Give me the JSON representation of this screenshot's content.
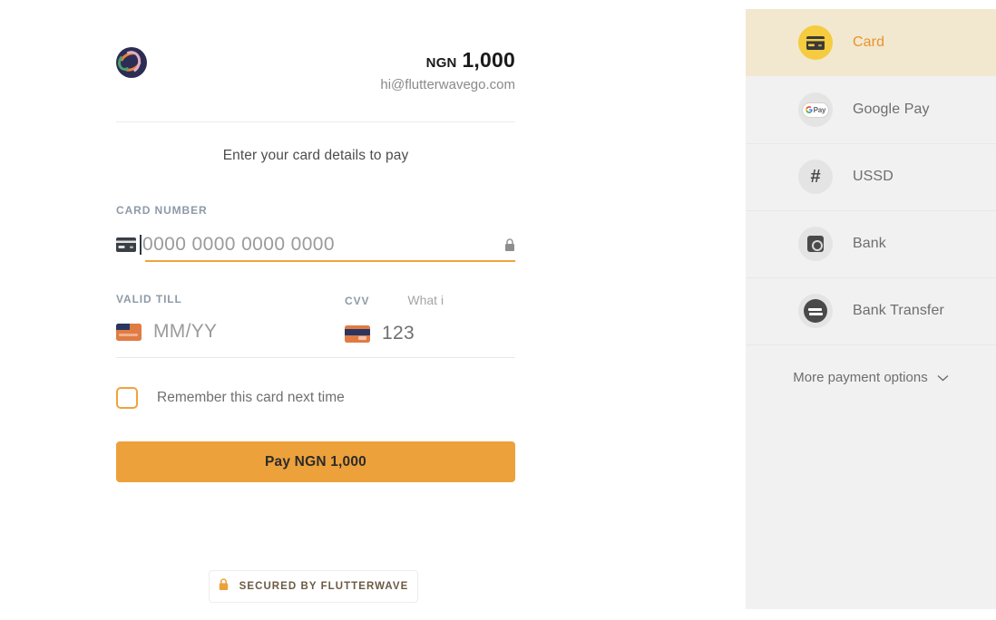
{
  "checkout": {
    "logo_icon": "flutterwave-merchant-logo",
    "currency": "NGN",
    "amount": "1,000",
    "merchant_email": "hi@flutterwavego.com",
    "instruction": "Enter your card details to pay",
    "card_number": {
      "label": "CARD NUMBER",
      "placeholder": "0000 0000 0000 0000",
      "value": "",
      "left_icon": "credit-card-icon",
      "right_icon": "lock-icon"
    },
    "valid_till": {
      "label": "VALID TILL",
      "placeholder": "MM/YY",
      "value": "",
      "icon": "card-front-icon"
    },
    "cvv": {
      "label": "CVV",
      "placeholder": "123",
      "value": "",
      "icon": "card-back-icon",
      "help_link": "What i"
    },
    "remember_card": {
      "label": "Remember this card next time",
      "checked": false
    },
    "pay_button": "Pay NGN 1,000",
    "secured_badge": {
      "text": "SECURED BY FLUTTERWAVE",
      "icon": "padlock-icon"
    }
  },
  "sidebar": {
    "methods": [
      {
        "label": "Card",
        "icon": "credit-card-icon",
        "active": true
      },
      {
        "label": "Google Pay",
        "icon": "google-pay-icon",
        "active": false
      },
      {
        "label": "USSD",
        "icon": "hash-icon",
        "active": false
      },
      {
        "label": "Bank",
        "icon": "safe-vault-icon",
        "active": false
      },
      {
        "label": "Bank Transfer",
        "icon": "transfer-arrows-icon",
        "active": false
      }
    ],
    "more_options": {
      "label": "More payment options",
      "icon": "chevron-down-icon"
    }
  },
  "colors": {
    "accent_orange": "#eda13a",
    "active_row_bg": "#f2e8cf",
    "active_icon_bg": "#f5cb3f",
    "sidebar_bg": "#f1f1f1",
    "label_gray": "#8e9aa8",
    "logo_navy": "#2b2d55"
  }
}
